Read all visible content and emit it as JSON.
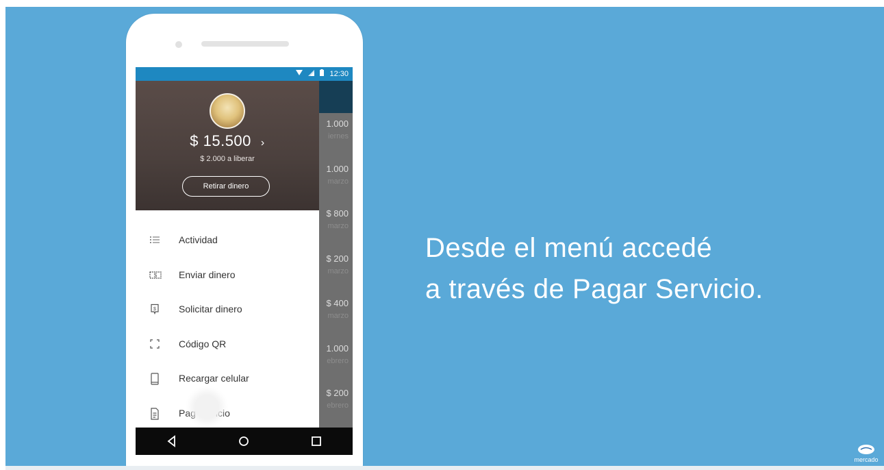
{
  "status": {
    "time": "12:30"
  },
  "header": {
    "balance": "$ 15.500",
    "balance_chevron": "›",
    "balance_sub": "$ 2.000 a liberar",
    "withdraw_label": "Retirar dinero"
  },
  "menu": [
    {
      "label": "Actividad",
      "icon": "list-icon"
    },
    {
      "label": "Enviar dinero",
      "icon": "money-icon"
    },
    {
      "label": "Solicitar dinero",
      "icon": "request-money-icon"
    },
    {
      "label": "Código QR",
      "icon": "qr-icon"
    },
    {
      "label": "Recargar celular",
      "icon": "phone-icon"
    },
    {
      "label_left": "Pag",
      "label_right": "vicio",
      "icon": "document-icon"
    }
  ],
  "background_list": [
    {
      "amount": "1.000",
      "date": "iernes"
    },
    {
      "amount": "1.000",
      "date": "marzo"
    },
    {
      "amount": "$ 800",
      "date": "marzo"
    },
    {
      "amount": "$ 200",
      "date": "marzo"
    },
    {
      "amount": "$ 400",
      "date": "marzo"
    },
    {
      "amount": "1.000",
      "date": "ebrero"
    },
    {
      "amount": "$ 200",
      "date": "ebrero"
    }
  ],
  "headline": {
    "line1": "Desde el menú accedé",
    "line2": "a través de Pagar Servicio."
  },
  "logo": {
    "text": "mercado"
  },
  "colors": {
    "background": "#5aa9d8",
    "status_bar": "#1e88c1",
    "app_bar": "#163e55"
  }
}
